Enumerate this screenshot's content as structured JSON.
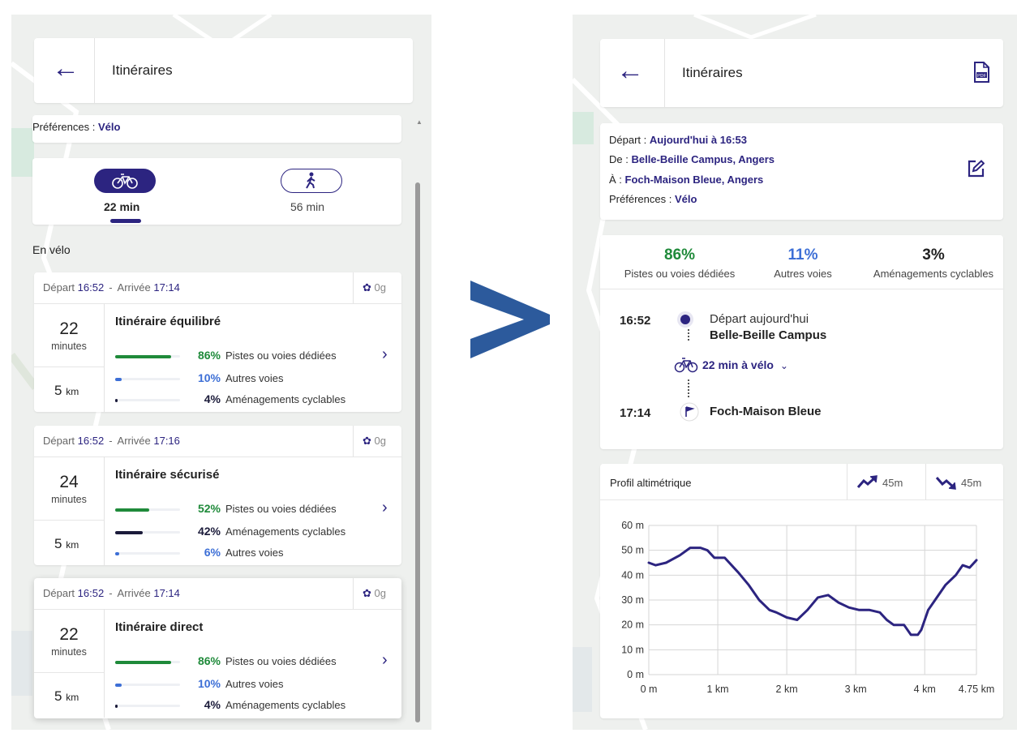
{
  "left": {
    "header": {
      "title": "Itinéraires"
    },
    "preferences": {
      "label": "Préférences :",
      "value": "Vélo"
    },
    "modes": [
      {
        "icon": "bicycle-icon",
        "time": "22 min",
        "selected": true
      },
      {
        "icon": "walking-person-icon",
        "time": "56 min",
        "selected": false
      }
    ],
    "section_title": "En vélo",
    "routes": [
      {
        "depart_label": "Départ",
        "depart_time": "16:52",
        "separator": "-",
        "arrive_label": "Arrivée",
        "arrive_time": "17:14",
        "co2": "0g",
        "minutes_value": "22",
        "minutes_label": "minutes",
        "km_value": "5",
        "km_unit": "km",
        "name": "Itinéraire équilibré",
        "bars": [
          {
            "percent": "86%",
            "label": "Pistes ou voies dédiées",
            "fraction": 0.86,
            "color": "#1f8a3a"
          },
          {
            "percent": "10%",
            "label": "Autres voies",
            "fraction": 0.1,
            "color": "#3d6fd6"
          },
          {
            "percent": "4%",
            "label": "Aménagements cyclables",
            "fraction": 0.04,
            "color": "#1b1b3a"
          }
        ]
      },
      {
        "depart_label": "Départ",
        "depart_time": "16:52",
        "separator": "-",
        "arrive_label": "Arrivée",
        "arrive_time": "17:16",
        "co2": "0g",
        "minutes_value": "24",
        "minutes_label": "minutes",
        "km_value": "5",
        "km_unit": "km",
        "name": "Itinéraire sécurisé",
        "bars": [
          {
            "percent": "52%",
            "label": "Pistes ou voies dédiées",
            "fraction": 0.52,
            "color": "#1f8a3a"
          },
          {
            "percent": "42%",
            "label": "Aménagements cyclables",
            "fraction": 0.42,
            "color": "#1b1b3a"
          },
          {
            "percent": "6%",
            "label": "Autres voies",
            "fraction": 0.06,
            "color": "#3d6fd6"
          }
        ]
      },
      {
        "depart_label": "Départ",
        "depart_time": "16:52",
        "separator": "-",
        "arrive_label": "Arrivée",
        "arrive_time": "17:14",
        "co2": "0g",
        "minutes_value": "22",
        "minutes_label": "minutes",
        "km_value": "5",
        "km_unit": "km",
        "name": "Itinéraire direct",
        "bars": [
          {
            "percent": "86%",
            "label": "Pistes ou voies dédiées",
            "fraction": 0.86,
            "color": "#1f8a3a"
          },
          {
            "percent": "10%",
            "label": "Autres voies",
            "fraction": 0.1,
            "color": "#3d6fd6"
          },
          {
            "percent": "4%",
            "label": "Aménagements cyclables",
            "fraction": 0.04,
            "color": "#1b1b3a"
          }
        ]
      }
    ]
  },
  "right": {
    "header": {
      "title": "Itinéraires"
    },
    "summary": {
      "depart_label": "Départ :",
      "depart_value": "Aujourd'hui à 16:53",
      "from_label": "De :",
      "from_value": "Belle-Beille Campus, Angers",
      "to_label": "À :",
      "to_value": "Foch-Maison Bleue, Angers",
      "pref_label": "Préférences :",
      "pref_value": "Vélo"
    },
    "stats": [
      {
        "percent": "86%",
        "label": "Pistes ou voies dédiées",
        "color": "#1f8a3a"
      },
      {
        "percent": "11%",
        "label": "Autres voies",
        "color": "#3d6fd6"
      },
      {
        "percent": "3%",
        "label": "Aménagements cyclables",
        "color": "#222222"
      }
    ],
    "timeline": {
      "start_time": "16:52",
      "start_caption": "Départ aujourd'hui",
      "start_place": "Belle-Beille Campus",
      "ride_text": "22 min à vélo",
      "end_time": "17:14",
      "end_place": "Foch-Maison Bleue"
    },
    "elevation": {
      "title": "Profil altimétrique",
      "ascent": "45m",
      "descent": "45m"
    }
  },
  "chart_data": {
    "type": "line",
    "title": "Profil altimétrique",
    "xlabel": "",
    "ylabel": "",
    "x_ticks": [
      "0 m",
      "1 km",
      "2 km",
      "3 km",
      "4 km",
      "4.75 km"
    ],
    "y_ticks": [
      "60 m",
      "50 m",
      "40 m",
      "30 m",
      "20 m",
      "10 m",
      "0 m"
    ],
    "xlim": [
      0,
      4.75
    ],
    "ylim": [
      0,
      60
    ],
    "grid": true,
    "series": [
      {
        "x": [
          0,
          0.1,
          0.25,
          0.45,
          0.6,
          0.75,
          0.85,
          0.95,
          1.1,
          1.3,
          1.45,
          1.6,
          1.75,
          1.85,
          2.0,
          2.15,
          2.3,
          2.45,
          2.6,
          2.75,
          2.9,
          3.05,
          3.2,
          3.35,
          3.45,
          3.55,
          3.7,
          3.8,
          3.9,
          3.95,
          4.05,
          4.15,
          4.3,
          4.45,
          4.55,
          4.65,
          4.75
        ],
        "y": [
          45,
          44,
          45,
          48,
          51,
          51,
          50,
          47,
          47,
          41,
          36,
          30,
          26,
          25,
          23,
          22,
          26,
          31,
          32,
          29,
          27,
          26,
          26,
          25,
          22,
          20,
          20,
          16,
          16,
          18,
          26,
          30,
          36,
          40,
          44,
          43,
          46
        ]
      }
    ]
  }
}
